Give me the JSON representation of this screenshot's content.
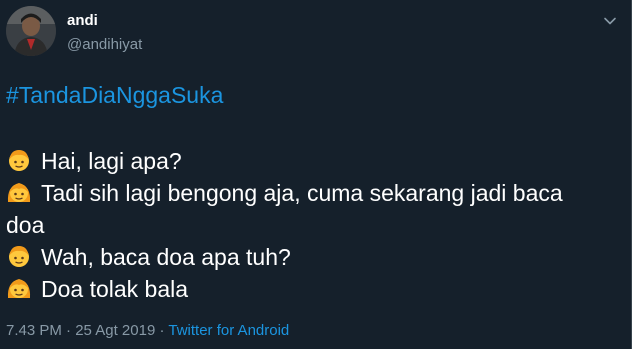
{
  "tweet": {
    "display_name": "andi",
    "handle": "@andihiyat",
    "hashtag": "#TandaDiaNggaSuka",
    "lines": [
      {
        "emoji": "boy-emoji-icon",
        "text": "Hai, lagi apa?"
      },
      {
        "emoji": "girl-emoji-icon",
        "text": "Tadi sih lagi bengong aja, cuma sekarang jadi baca"
      },
      {
        "emoji": "",
        "text": "doa"
      },
      {
        "emoji": "boy-emoji-icon",
        "text": "Wah, baca doa apa tuh?"
      },
      {
        "emoji": "girl-emoji-icon",
        "text": "Doa tolak bala"
      }
    ],
    "time": "7.43 PM",
    "separator": "·",
    "date": "25 Agt 2019",
    "source": "Twitter for Android",
    "icons": {
      "menu": "chevron-down-icon",
      "avatar": "avatar"
    }
  },
  "colors": {
    "background": "#15202b",
    "text": "#ffffff",
    "muted": "#8899a6",
    "link": "#1b95e0"
  }
}
